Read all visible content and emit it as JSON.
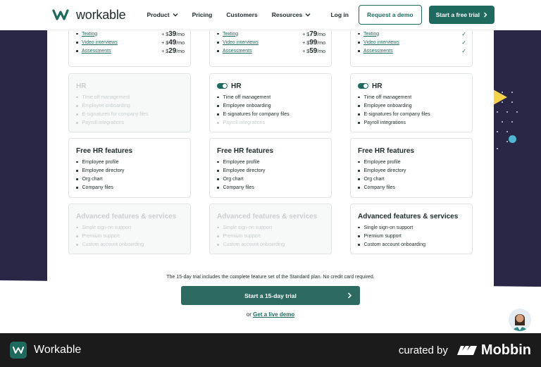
{
  "header": {
    "brand": "workable",
    "nav": [
      {
        "label": "Product",
        "dropdown": true
      },
      {
        "label": "Pricing",
        "dropdown": false
      },
      {
        "label": "Customers",
        "dropdown": false
      },
      {
        "label": "Resources",
        "dropdown": true
      }
    ],
    "login": "Log in",
    "request_demo": "Request a demo",
    "start_trial": "Start a free trial"
  },
  "plans": [
    {
      "addons": [
        {
          "label": "Texting",
          "price_prefix": "+ $",
          "price": "39",
          "unit": "/mo"
        },
        {
          "label": "Video interviews",
          "price_prefix": "+ $",
          "price": "49",
          "unit": "/mo"
        },
        {
          "label": "Assessments",
          "price_prefix": "+ $",
          "price": "29",
          "unit": "/mo"
        }
      ],
      "hr": {
        "title": "HR",
        "enabled": false,
        "items": [
          "Time off management",
          "Employee onboarding",
          "E-signatures for company files",
          "Payroll integrations"
        ],
        "dim": [
          true,
          true,
          true,
          true
        ]
      },
      "free_hr": {
        "title": "Free HR features",
        "items": [
          "Employee profile",
          "Employee directory",
          "Org chart",
          "Company files"
        ]
      },
      "advanced": {
        "title": "Advanced features & services",
        "enabled": false,
        "items": [
          "Single sign-on support",
          "Premium support",
          "Custom account onboarding"
        ]
      }
    },
    {
      "addons": [
        {
          "label": "Texting",
          "price_prefix": "+ $",
          "price": "79",
          "unit": "/mo"
        },
        {
          "label": "Video interviews",
          "price_prefix": "+ $",
          "price": "99",
          "unit": "/mo"
        },
        {
          "label": "Assessments",
          "price_prefix": "+ $",
          "price": "59",
          "unit": "/mo"
        }
      ],
      "hr": {
        "title": "HR",
        "enabled": true,
        "items": [
          "Time off management",
          "Employee onboarding",
          "E-signatures for company files",
          "Payroll integrations"
        ],
        "dim": [
          false,
          false,
          false,
          true
        ]
      },
      "free_hr": {
        "title": "Free HR features",
        "items": [
          "Employee profile",
          "Employee directory",
          "Org chart",
          "Company files"
        ]
      },
      "advanced": {
        "title": "Advanced features & services",
        "enabled": false,
        "items": [
          "Single sign-on support",
          "Premium support",
          "Custom account onboarding"
        ]
      }
    },
    {
      "addons": [
        {
          "label": "Texting",
          "check": "✓"
        },
        {
          "label": "Video interviews",
          "check": "✓"
        },
        {
          "label": "Assessments",
          "check": "✓"
        }
      ],
      "hr": {
        "title": "HR",
        "enabled": true,
        "items": [
          "Time off management",
          "Employee onboarding",
          "E-signatures for company files",
          "Payroll integrations"
        ],
        "dim": [
          false,
          false,
          false,
          false
        ]
      },
      "free_hr": {
        "title": "Free HR features",
        "items": [
          "Employee profile",
          "Employee directory",
          "Org chart",
          "Company files"
        ]
      },
      "advanced": {
        "title": "Advanced features & services",
        "enabled": true,
        "items": [
          "Single sign-on support",
          "Premium support",
          "Custom account onboarding"
        ]
      }
    }
  ],
  "note": "The 15-day trial includes the complete feature set of the Standard plan. No credit card required.",
  "cta": "Start a 15-day trial",
  "demo_prefix": "or",
  "demo_link": "Get a live demo",
  "footer": {
    "app_name": "Workable",
    "curated_by": "curated by",
    "brand": "Mobbin"
  },
  "colors": {
    "accent": "#1f6a5e",
    "background": "#2a2646"
  }
}
